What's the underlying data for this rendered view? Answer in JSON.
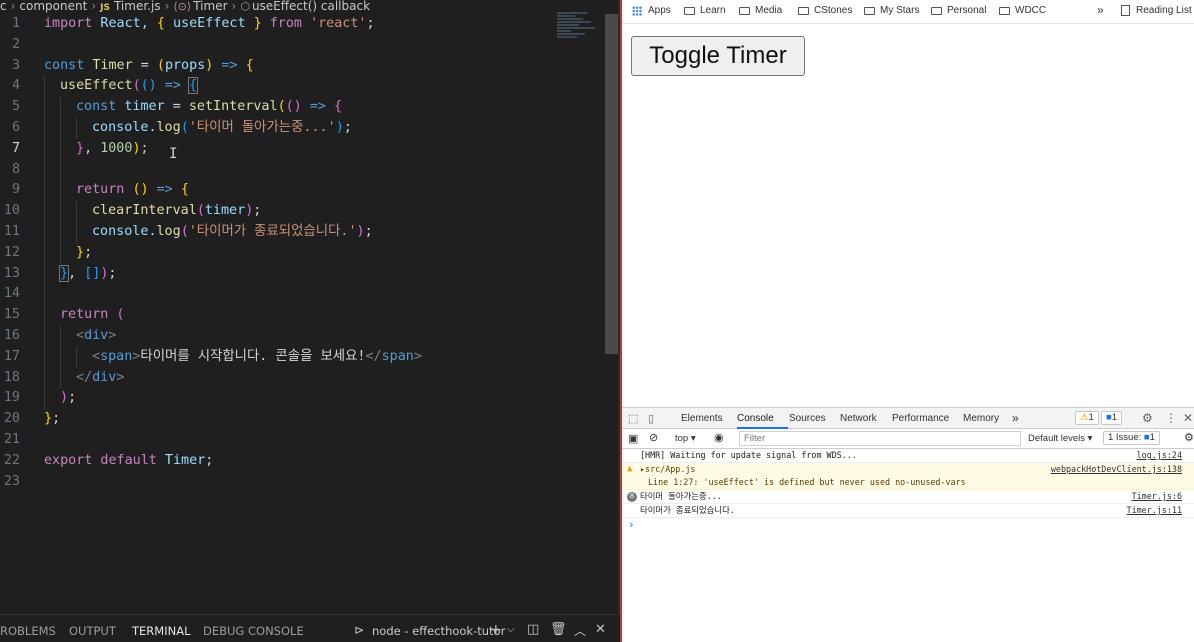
{
  "editor": {
    "breadcrumb": {
      "folder_prefix": "c",
      "folder": "component",
      "file_badge": "JS",
      "file": "Timer.js",
      "symbol1": "Timer",
      "symbol2": "useEffect() callback"
    },
    "line_numbers": [
      "1",
      "2",
      "3",
      "4",
      "5",
      "6",
      "7",
      "8",
      "9",
      "10",
      "11",
      "12",
      "13",
      "14",
      "15",
      "16",
      "17",
      "18",
      "19",
      "20",
      "21",
      "22",
      "23"
    ],
    "active_line": 7,
    "code": {
      "l1": {
        "kw": "import",
        "a": " React, ",
        "b": "{",
        "c": " useEffect ",
        "d": "}",
        "e": " from ",
        "f": "'react'",
        "g": ";"
      },
      "l3": {
        "kw": "const",
        "name": " Timer",
        "eq": " = ",
        "p1": "(",
        "arg": "props",
        "p2": ")",
        "arrow": " => ",
        "br": "{"
      },
      "l4": {
        "fn": "useEffect",
        "p1": "(",
        "p2": "()",
        "arrow": " => ",
        "br": "{"
      },
      "l5": {
        "kw": "const",
        "name": " timer",
        "eq": " = ",
        "fn": "setInterval",
        "p1": "(",
        "p2": "()",
        "arrow": " => ",
        "br": "{"
      },
      "l6": {
        "obj": "console",
        "dot": ".",
        "fn": "log",
        "p1": "(",
        "str": "'타이머 돌아가는중...'",
        "p2": ")",
        "semi": ";"
      },
      "l7": {
        "br": "}",
        "comma": ", ",
        "num": "1000",
        "p": ")",
        "semi": ";"
      },
      "l9": {
        "kw": "return",
        "sp": " ",
        "p": "()",
        "arrow": " => ",
        "br": "{"
      },
      "l10": {
        "fn": "clearInterval",
        "p1": "(",
        "arg": "timer",
        "p2": ")",
        "semi": ";"
      },
      "l11": {
        "obj": "console",
        "dot": ".",
        "fn": "log",
        "p1": "(",
        "str": "'타이머가 종료되었습니다.'",
        "p2": ")",
        "semi": ";"
      },
      "l12": {
        "br": "}",
        "semi": ";"
      },
      "l13": {
        "br": "}",
        "comma": ", ",
        "arr": "[]",
        "p": ")",
        "semi": ";"
      },
      "l15": {
        "kw": "return",
        "p": " ("
      },
      "l16": {
        "lt": "<",
        "tag": "div",
        "gt": ">"
      },
      "l17": {
        "lt": "<",
        "tag": "span",
        "gt": ">",
        "text": "타이머를 시작합니다. 콘솔을 보세요!",
        "clt": "</",
        "ctag": "span",
        "cgt": ">"
      },
      "l18": {
        "clt": "</",
        "tag": "div",
        "gt": ">"
      },
      "l19": {
        "p": ")",
        "semi": ";"
      },
      "l20": {
        "br": "}",
        "semi": ";"
      },
      "l22": {
        "kw": "export",
        "kw2": " default",
        "name": " Timer",
        "semi": ";"
      }
    },
    "cursor_glyph": "I"
  },
  "panel": {
    "tabs": [
      "ROBLEMS",
      "OUTPUT",
      "TERMINAL",
      "DEBUG CONSOLE"
    ],
    "active_tab": "TERMINAL",
    "terminal_name": "node - effecthook-tutor"
  },
  "browser": {
    "bookmarks": {
      "apps": "Apps",
      "folders": [
        "Learn",
        "Media",
        "CStones",
        "My Stars",
        "Personal",
        "WDCC"
      ],
      "overflow": "»",
      "reading_list": "Reading List"
    },
    "page": {
      "button_label": "Toggle Timer"
    },
    "devtools": {
      "tabs": [
        "Elements",
        "Console",
        "Sources",
        "Network",
        "Performance",
        "Memory"
      ],
      "active_tab": "Console",
      "more": "»",
      "warn_count": "1",
      "msg_count": "1",
      "toolbar": {
        "context": "top ▾",
        "filter_placeholder": "Filter",
        "levels": "Default levels ▾",
        "issues": "1 Issue:",
        "issues_count": "1"
      },
      "messages": [
        {
          "text": "[HMR] Waiting for update signal from WDS...",
          "source": "log.js:24"
        },
        {
          "text": "▸src/App.js",
          "detail": "Line 1:27:  'useEffect' is defined but never used  no-unused-vars",
          "source": "webpackHotDevClient.js:138"
        },
        {
          "count": "8",
          "text": "타이머 돌아가는중...",
          "source": "Timer.js:6"
        },
        {
          "text": "타이머가 종료되었습니다.",
          "source": "Timer.js:11"
        }
      ],
      "prompt": "›"
    }
  },
  "colors": {
    "editor_bg": "#1f1f1f",
    "keyword": "#c586c0",
    "string": "#ce9178",
    "devtools_accent": "#1a73e8",
    "warning_bg": "#fffbe5"
  }
}
